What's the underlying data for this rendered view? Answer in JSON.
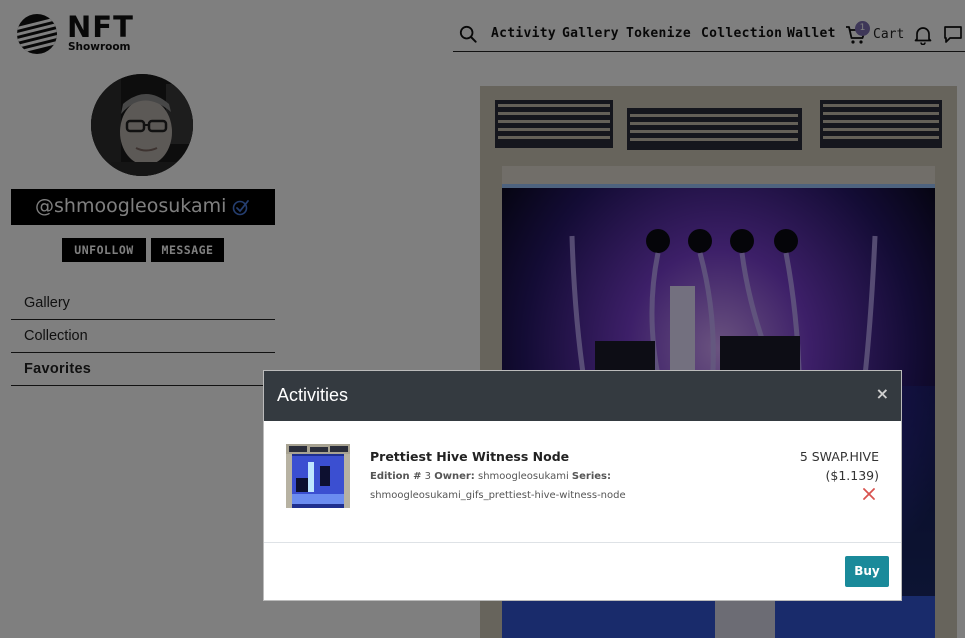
{
  "brand": {
    "title": "NFT",
    "subtitle": "Showroom",
    "logo_icon": "waves-globe-icon"
  },
  "nav": {
    "items": [
      "Activity",
      "Gallery",
      "Tokenize",
      "Collection",
      "Wallet"
    ],
    "cart_label": "Cart",
    "cart_count": "1",
    "icons": [
      "search-icon",
      "cart-icon",
      "bell-icon",
      "chat-icon"
    ]
  },
  "profile": {
    "username": "@shmoogleosukami",
    "verified_icon": "verified-check-icon",
    "unfollow_label": "UNFOLLOW",
    "message_label": "MESSAGE"
  },
  "sidebar": {
    "items": [
      {
        "label": "Gallery",
        "active": false
      },
      {
        "label": "Collection",
        "active": false
      },
      {
        "label": "Favorites",
        "active": true
      }
    ]
  },
  "modal": {
    "title": "Activities",
    "close_label": "×",
    "item": {
      "name": "Prettiest Hive Witness Node",
      "edition_label": "Edition #",
      "edition_number": "3",
      "owner_label": "Owner:",
      "owner": "shmoogleosukami",
      "series_label": "Series:",
      "series": "shmoogleosukami_gifs_prettiest-hive-witness-node",
      "price": "5 SWAP.HIVE",
      "price_usd": "($1.139)"
    },
    "buy_label": "Buy"
  },
  "colors": {
    "modal_header": "#343a40",
    "buy_button": "#1a8a9a",
    "remove_icon": "#d9534f",
    "cart_badge": "#7c6fb0",
    "overlay": "rgba(0,0,0,0.5)"
  }
}
